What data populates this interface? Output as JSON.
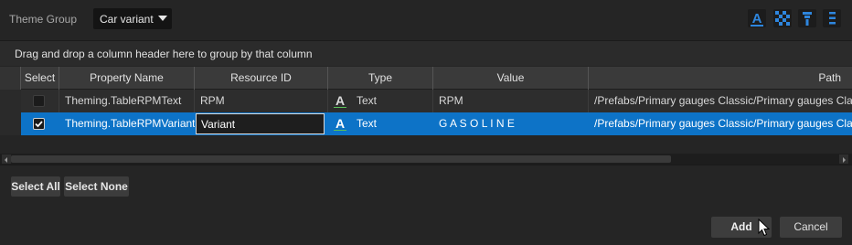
{
  "top_bar": {
    "theme_group_label": "Theme Group",
    "theme_group_value": "Car variant",
    "tools": [
      "text-style-icon",
      "checkerboard-icon",
      "filter-icon",
      "list-icon"
    ]
  },
  "grid": {
    "group_panel_hint": "Drag and drop a column header here to group by that column",
    "columns": [
      "Select",
      "Property Name",
      "Resource ID",
      "Type",
      "Value",
      "Path"
    ],
    "rows": [
      {
        "selected": false,
        "property_name": "Theming.TableRPMText",
        "resource_id": "RPM",
        "type": "Text",
        "value": "RPM",
        "path": "/Prefabs/Primary gauges Classic/Primary gauges Classic"
      },
      {
        "selected": true,
        "property_name": "Theming.TableRPMVariant",
        "resource_id": "Variant",
        "type": "Text",
        "value": "G A S O L I N E",
        "path": "/Prefabs/Primary gauges Classic/Primary gauges Classic"
      }
    ]
  },
  "actions": {
    "select_all": "Select All",
    "select_none": "Select None",
    "add": "Add",
    "cancel": "Cancel"
  },
  "colors": {
    "accent": "#0d73c7",
    "icon_blue": "#2e86de",
    "text_icon_green": "#58c058"
  }
}
